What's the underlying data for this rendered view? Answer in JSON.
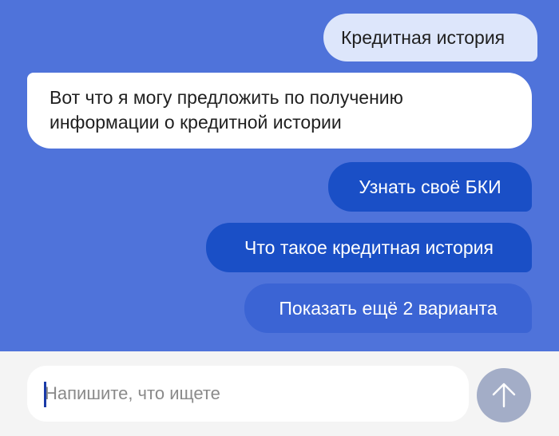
{
  "chat": {
    "user_message": "Кредитная история",
    "bot_message_line1": "Вот что я могу предложить по получению",
    "bot_message_line2": "информации о кредитной истории",
    "options": [
      {
        "label": "Узнать своё БКИ"
      },
      {
        "label": "Что такое кредитная история"
      },
      {
        "label": "Показать ещё 2 варианта"
      }
    ]
  },
  "input": {
    "placeholder": "Напишите, что ищете",
    "value": ""
  },
  "send_button": {
    "icon": "arrow-up-icon"
  },
  "colors": {
    "chat_background": "#4f73da",
    "user_bubble": "#dde6fb",
    "bot_bubble": "#ffffff",
    "option_bubble": "#1a4fc6",
    "more_option_bubble": "#3b64d4",
    "input_bar": "#f4f4f4",
    "send_button": "#a3adc7"
  }
}
